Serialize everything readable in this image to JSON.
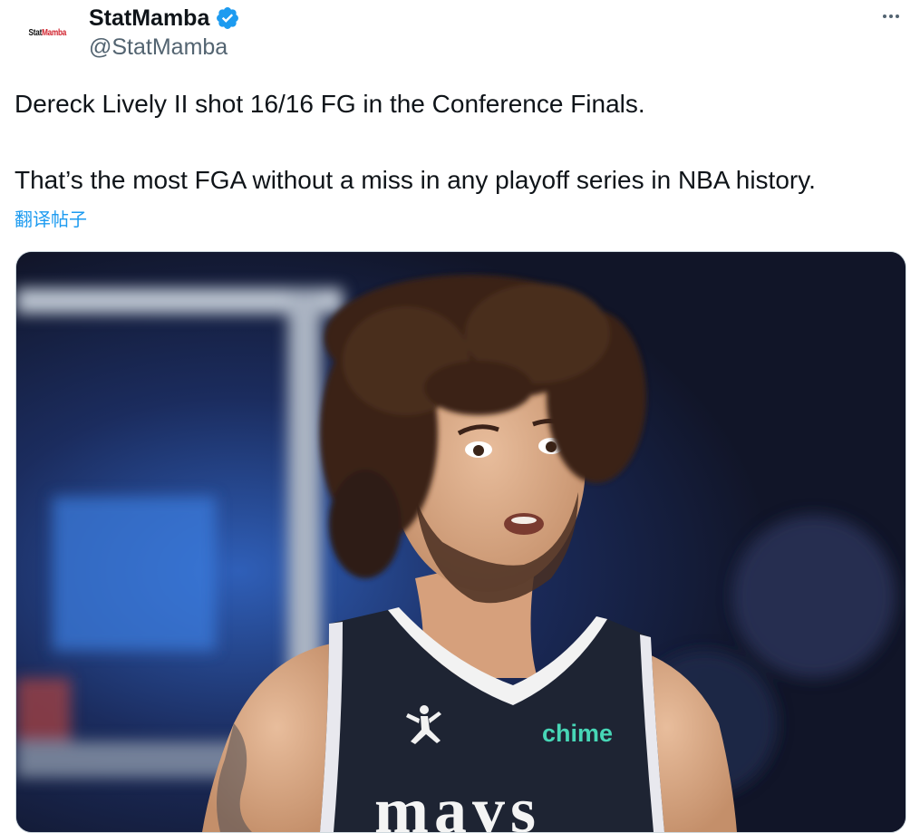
{
  "author": {
    "display_name": "StatMamba",
    "handle": "@StatMamba",
    "verified": true,
    "avatar_logo": {
      "part1": "Stat",
      "part2": "Mamba"
    }
  },
  "menu": {
    "icon": "more-horizontal-icon"
  },
  "tweet": {
    "line1": "Dereck Lively II shot 16/16 FG in the Conference Finals.",
    "line2": "That’s the most FGA without a miss in any playoff series in NBA history."
  },
  "translate_label": "翻译帖子",
  "media": {
    "type": "photo",
    "jersey_sponsor": "chime",
    "jersey_wordmark": "mavs"
  },
  "colors": {
    "text": "#0f1419",
    "secondary": "#536471",
    "link": "#1d9bf0",
    "verified": "#1d9bf0"
  }
}
